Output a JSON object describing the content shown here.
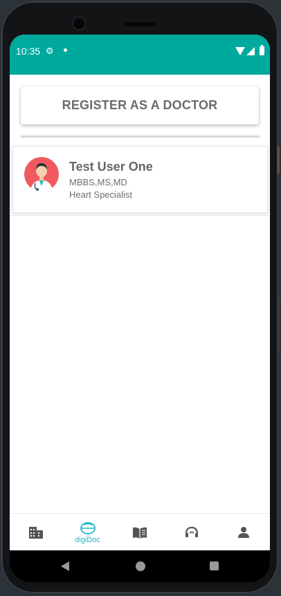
{
  "status_bar": {
    "time": "10:35"
  },
  "main": {
    "register_button_label": "REGISTER AS A DOCTOR",
    "doctors": [
      {
        "name": "Test User One",
        "degree": "MBBS,MS,MD",
        "specialty": "Heart Specialist"
      }
    ]
  },
  "bottom_nav": {
    "items": [
      {
        "icon": "hospital-building-icon",
        "label": ""
      },
      {
        "icon": "digidoc-icon",
        "label": "digiDoc",
        "active": true
      },
      {
        "icon": "book-icon",
        "label": ""
      },
      {
        "icon": "support-headset-icon",
        "label": ""
      },
      {
        "icon": "person-icon",
        "label": ""
      }
    ]
  },
  "colors": {
    "primary": "#00a99d",
    "active_tab": "#1fb7c9"
  }
}
